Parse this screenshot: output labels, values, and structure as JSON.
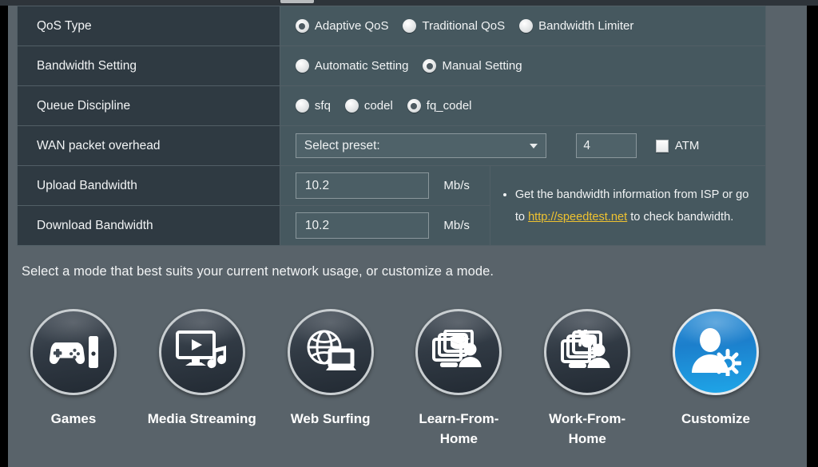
{
  "settings": {
    "rows": [
      {
        "label": "QoS Type",
        "type": "radio",
        "options": [
          {
            "label": "Adaptive QoS",
            "selected": true
          },
          {
            "label": "Traditional QoS",
            "selected": false
          },
          {
            "label": "Bandwidth Limiter",
            "selected": false
          }
        ]
      },
      {
        "label": "Bandwidth Setting",
        "type": "radio",
        "options": [
          {
            "label": "Automatic Setting",
            "selected": false
          },
          {
            "label": "Manual Setting",
            "selected": true
          }
        ]
      },
      {
        "label": "Queue Discipline",
        "type": "radio",
        "options": [
          {
            "label": "sfq",
            "selected": false
          },
          {
            "label": "codel",
            "selected": false
          },
          {
            "label": "fq_codel",
            "selected": true
          }
        ]
      },
      {
        "label": "WAN packet overhead",
        "type": "preset"
      },
      {
        "label": "Upload Bandwidth",
        "type": "bandwidth"
      },
      {
        "label": "Download Bandwidth",
        "type": "bandwidth"
      }
    ],
    "wan_overhead": {
      "select_value": "Select preset:",
      "overhead_value": "4",
      "atm_label": "ATM",
      "atm_checked": false
    },
    "upload": {
      "value": "10.2",
      "unit": "Mb/s"
    },
    "download": {
      "value": "10.2",
      "unit": "Mb/s"
    },
    "hint": {
      "text_before": "Get the bandwidth information from ISP or go to ",
      "link_text": "http://speedtest.net",
      "text_after": " to check bandwidth."
    }
  },
  "modes": {
    "description": "Select a mode that best suits your current network usage, or customize a mode.",
    "items": [
      {
        "label": "Games",
        "icon": "gamepad-console-icon",
        "selected": false
      },
      {
        "label": "Media Streaming",
        "icon": "monitor-play-music-icon",
        "selected": false
      },
      {
        "label": "Web Surfing",
        "icon": "globe-laptop-icon",
        "selected": false
      },
      {
        "label": "Learn-From-Home",
        "icon": "graduation-screen-person-icon",
        "selected": false
      },
      {
        "label": "Work-From-Home",
        "icon": "headset-screen-person-icon",
        "selected": false
      },
      {
        "label": "Customize",
        "icon": "user-gear-icon",
        "selected": true
      }
    ]
  },
  "colors": {
    "label_cell": "#2f3a42",
    "value_cell": "#46585f",
    "panel_bg": "#59636a",
    "link": "#f0c330",
    "accent_selected": "#1f8fd6"
  }
}
